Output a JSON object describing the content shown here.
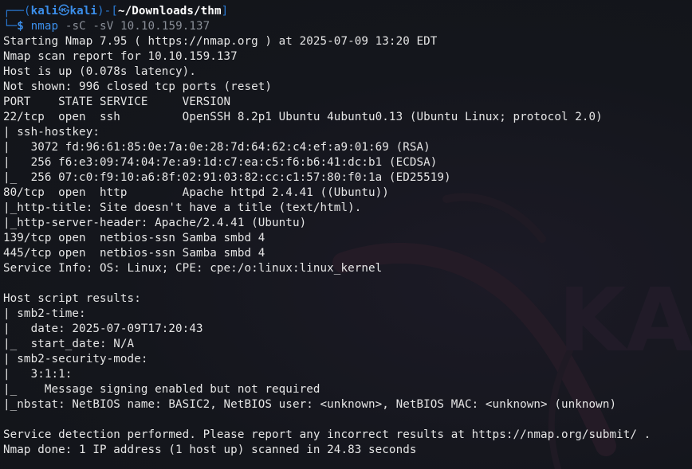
{
  "prompt": {
    "box_open": "┌──(",
    "user": "kali",
    "skull": "㉿",
    "host": "kali",
    "mid": ")-[",
    "path": "~/Downloads/thm",
    "box_close": "]",
    "corner": "└─",
    "dollar": "$",
    "command": "nmap",
    "args": "-sC -sV 10.10.159.137"
  },
  "output": [
    "Starting Nmap 7.95 ( https://nmap.org ) at 2025-07-09 13:20 EDT",
    "Nmap scan report for 10.10.159.137",
    "Host is up (0.078s latency).",
    "Not shown: 996 closed tcp ports (reset)",
    "PORT    STATE SERVICE     VERSION",
    "22/tcp  open  ssh         OpenSSH 8.2p1 Ubuntu 4ubuntu0.13 (Ubuntu Linux; protocol 2.0)",
    "| ssh-hostkey:",
    "|   3072 fd:96:61:85:0e:7a:0e:28:7d:64:62:c4:ef:a9:01:69 (RSA)",
    "|   256 f6:e3:09:74:04:7e:a9:1d:c7:ea:c5:f6:b6:41:dc:b1 (ECDSA)",
    "|_  256 07:c0:f9:10:a6:8f:02:91:03:82:cc:c1:57:80:f0:1a (ED25519)",
    "80/tcp  open  http        Apache httpd 2.4.41 ((Ubuntu))",
    "|_http-title: Site doesn't have a title (text/html).",
    "|_http-server-header: Apache/2.4.41 (Ubuntu)",
    "139/tcp open  netbios-ssn Samba smbd 4",
    "445/tcp open  netbios-ssn Samba smbd 4",
    "Service Info: OS: Linux; CPE: cpe:/o:linux:linux_kernel",
    "",
    "Host script results:",
    "| smb2-time:",
    "|   date: 2025-07-09T17:20:43",
    "|_  start_date: N/A",
    "| smb2-security-mode:",
    "|   3:1:1:",
    "|_    Message signing enabled but not required",
    "|_nbstat: NetBIOS name: BASIC2, NetBIOS user: <unknown>, NetBIOS MAC: <unknown> (unknown)",
    "",
    "Service detection performed. Please report any incorrect results at https://nmap.org/submit/ .",
    "Nmap done: 1 IP address (1 host up) scanned in 24.83 seconds"
  ],
  "watermark": "KALI",
  "colors": {
    "background": "#14161c",
    "text": "#e6e6e6",
    "prompt_blue": "#3b8eea",
    "args_gray": "#8a8f98"
  },
  "icons": {
    "watermark_logo": "kali-dragon-icon"
  }
}
